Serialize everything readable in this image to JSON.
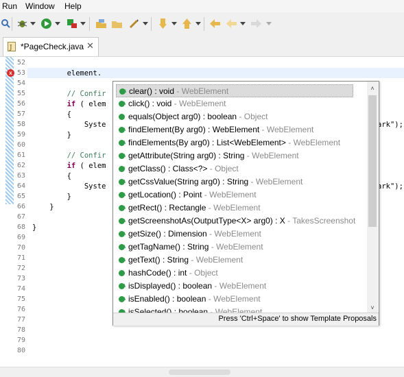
{
  "menu": {
    "run": "Run",
    "window": "Window",
    "help": "Help"
  },
  "toolbar": {
    "icons": [
      "search-icon",
      "debug-icon",
      "run-icon",
      "external-tools-icon",
      "open-type-icon",
      "open-folder-icon",
      "pen-icon",
      "annotation-icon",
      "next-annotation-icon",
      "last-edit-icon",
      "back-icon",
      "forward-icon"
    ]
  },
  "tab": {
    "label": "*PageCheck.java",
    "close": "✕"
  },
  "editor": {
    "line_numbers": [
      "52",
      "53",
      "54",
      "55",
      "56",
      "57",
      "58",
      "59",
      "60",
      "61",
      "62",
      "63",
      "64",
      "65",
      "66",
      "67",
      "68",
      "69",
      "70",
      "71",
      "72",
      "73",
      "74",
      "75",
      "76",
      "77",
      "78",
      "79",
      "80"
    ],
    "lines": [
      {
        "text": "",
        "indent": ""
      },
      {
        "text": "element.",
        "indent": "        "
      },
      {
        "text": "",
        "indent": ""
      },
      {
        "text": "// Confir",
        "indent": "        ",
        "style": "comment"
      },
      {
        "text": "if ( elem",
        "indent": "        ",
        "style": "if"
      },
      {
        "text": "{",
        "indent": "        "
      },
      {
        "text": "Syste",
        "indent": "            "
      },
      {
        "text": "}",
        "indent": "        "
      },
      {
        "text": "",
        "indent": ""
      },
      {
        "text": "// Confir",
        "indent": "        ",
        "style": "comment"
      },
      {
        "text": "if ( elem",
        "indent": "        ",
        "style": "if"
      },
      {
        "text": "{",
        "indent": "        "
      },
      {
        "text": "Syste",
        "indent": "            "
      },
      {
        "text": "}",
        "indent": "        "
      },
      {
        "text": "}",
        "indent": "    "
      },
      {
        "text": "",
        "indent": ""
      },
      {
        "text": "}",
        "indent": ""
      }
    ],
    "right_fragment_1": "ark\");",
    "right_fragment_2": "ark\");"
  },
  "popup": {
    "items": [
      {
        "sig": "clear() : void",
        "owner": "WebElement",
        "sup": "A"
      },
      {
        "sig": "click() : void",
        "owner": "WebElement",
        "sup": "A"
      },
      {
        "sig": "equals(Object arg0) : boolean",
        "owner": "Object",
        "sup": ""
      },
      {
        "sig": "findElement(By arg0) : WebElement",
        "owner": "WebElement",
        "sup": "A"
      },
      {
        "sig": "findElements(By arg0) : List<WebElement>",
        "owner": "WebElement",
        "sup": "A"
      },
      {
        "sig": "getAttribute(String arg0) : String",
        "owner": "WebElement",
        "sup": "A"
      },
      {
        "sig": "getClass() : Class<?>",
        "owner": "Object",
        "sup": "F"
      },
      {
        "sig": "getCssValue(String arg0) : String",
        "owner": "WebElement",
        "sup": "A"
      },
      {
        "sig": "getLocation() : Point",
        "owner": "WebElement",
        "sup": "A"
      },
      {
        "sig": "getRect() : Rectangle",
        "owner": "WebElement",
        "sup": "A"
      },
      {
        "sig": "getScreenshotAs(OutputType<X> arg0) : X",
        "owner": "TakesScreenshot",
        "sup": "A"
      },
      {
        "sig": "getSize() : Dimension",
        "owner": "WebElement",
        "sup": "A"
      },
      {
        "sig": "getTagName() : String",
        "owner": "WebElement",
        "sup": "A"
      },
      {
        "sig": "getText() : String",
        "owner": "WebElement",
        "sup": "A"
      },
      {
        "sig": "hashCode() : int",
        "owner": "Object",
        "sup": ""
      },
      {
        "sig": "isDisplayed() : boolean",
        "owner": "WebElement",
        "sup": "A"
      },
      {
        "sig": "isEnabled() : boolean",
        "owner": "WebElement",
        "sup": "A"
      },
      {
        "sig": "isSelected() : boolean",
        "owner": "WebElement",
        "sup": "A"
      }
    ],
    "separator": " - ",
    "footer": "Press 'Ctrl+Space' to show Template Proposals"
  }
}
